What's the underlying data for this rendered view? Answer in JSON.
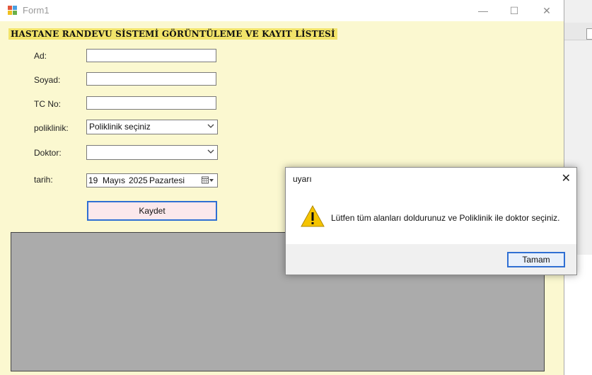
{
  "window": {
    "title": "Form1",
    "controls": {
      "minimize": "—",
      "maximize": "☐",
      "close": "✕"
    }
  },
  "form": {
    "heading": "HASTANE RANDEVU SİSTEMİ GÖRÜNTÜLEME VE KAYIT LİSTESİ",
    "labels": {
      "ad": "Ad:",
      "soyad": "Soyad:",
      "tcno": "TC No:",
      "poliklinik": "poliklinik:",
      "doktor": "Doktor:",
      "tarih": "tarih:"
    },
    "fields": {
      "ad": "",
      "soyad": "",
      "tcno": "",
      "poliklinik": "Poliklinik seçiniz",
      "doktor": "",
      "date_day": "19",
      "date_month": "Mayıs",
      "date_year": "2025",
      "date_weekday": "Pazartesi"
    },
    "save_button": "Kaydet"
  },
  "dialog": {
    "title": "uyarı",
    "close": "✕",
    "message": "Lütfen tüm alanları doldurunuz ve Poliklinik ile doktor seçiniz.",
    "ok_button": "Tamam",
    "icon": "warning-icon"
  },
  "colors": {
    "form_bg": "#fbf8d0",
    "heading_bg": "#f2e46a",
    "grid_bg": "#ababab",
    "accent_border": "#2f6fd3"
  }
}
